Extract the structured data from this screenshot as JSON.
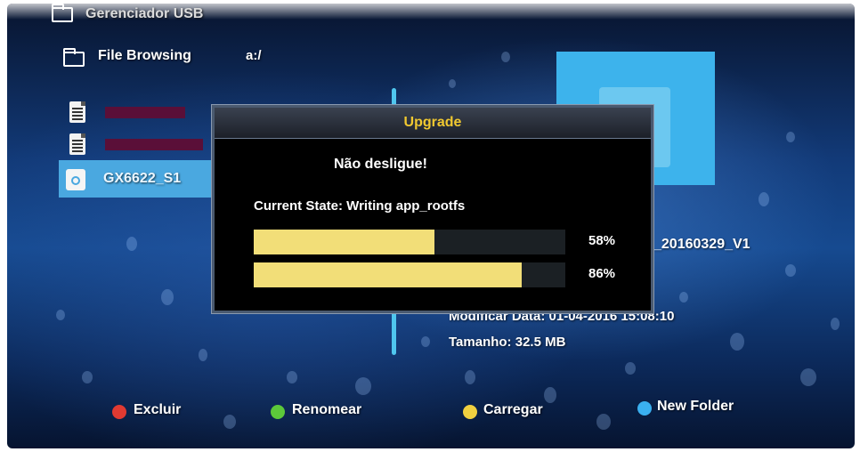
{
  "header": {
    "app_title": "Gerenciador USB"
  },
  "browser": {
    "title": "File Browsing",
    "path": "a:/",
    "files": [
      {
        "name": "",
        "icon": "document-icon"
      },
      {
        "name": "",
        "icon": "document-icon"
      },
      {
        "name": "GX6622_S1",
        "icon": "firmware-file-icon",
        "selected": true
      }
    ]
  },
  "details": {
    "filename_fragment": "_20160329_V1",
    "modified": "Modificar Data: 01-04-2016 15:08:10",
    "size": "Tamanho: 32.5 MB"
  },
  "dialog": {
    "title": "Upgrade",
    "warning": "Não desligue!",
    "state": "Current State: Writing app_rootfs",
    "progress": [
      {
        "percent_label": "58%",
        "value": 0.58
      },
      {
        "percent_label": "86%",
        "value": 0.86
      }
    ]
  },
  "footer": {
    "buttons": [
      {
        "label": "Excluir",
        "color": "#e03a32"
      },
      {
        "label": "Renomear",
        "color": "#5cc83a"
      },
      {
        "label": "Carregar",
        "color": "#f0d040"
      },
      {
        "label": "New Folder",
        "color": "#3ab0f0"
      }
    ]
  },
  "colors": {
    "accent": "#4aa8e0",
    "dialog_title": "#f0c830",
    "progress_fill": "#f2de78"
  }
}
